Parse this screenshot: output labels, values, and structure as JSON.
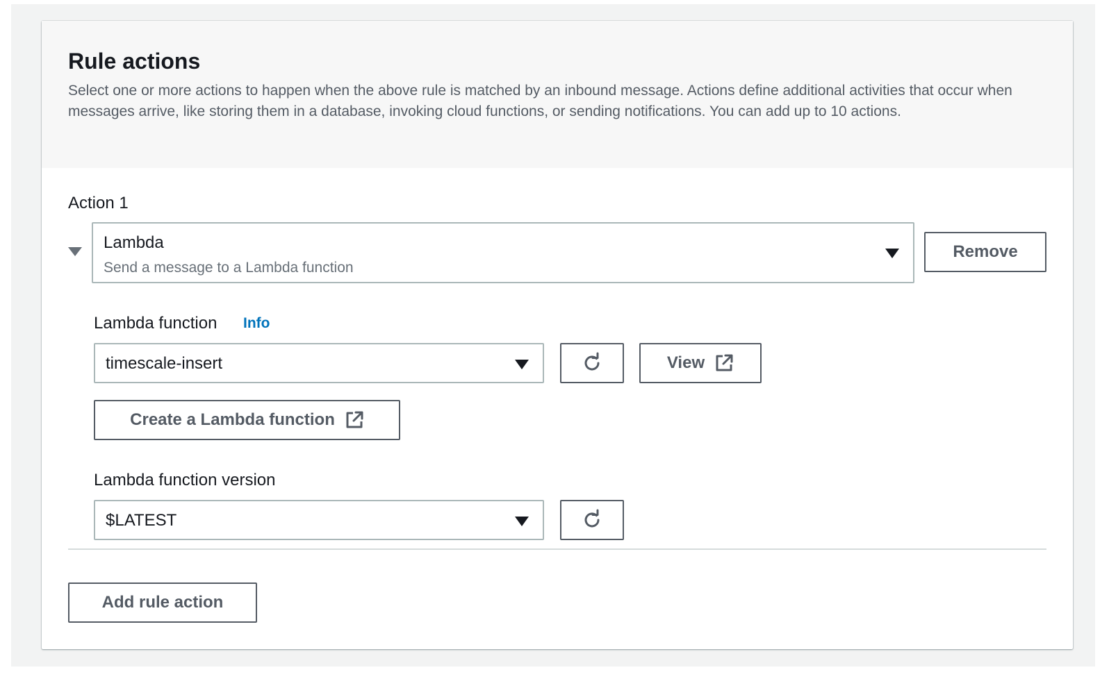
{
  "section": {
    "title": "Rule actions",
    "description": "Select one or more actions to happen when the above rule is matched by an inbound message. Actions define additional activities that occur when messages arrive, like storing them in a database, invoking cloud functions, or sending notifications. You can add up to 10 actions."
  },
  "action": {
    "label": "Action 1",
    "type_value": "Lambda",
    "type_description": "Send a message to a Lambda function",
    "remove_label": "Remove"
  },
  "lambda_function": {
    "label": "Lambda function",
    "info_label": "Info",
    "value": "timescale-insert",
    "view_label": "View",
    "create_label": "Create a Lambda function"
  },
  "lambda_version": {
    "label": "Lambda function version",
    "value": "$LATEST"
  },
  "footer": {
    "add_label": "Add rule action"
  },
  "icons": {
    "collapse": "caret-down-icon",
    "dropdown": "caret-down-icon",
    "refresh": "refresh-icon",
    "external": "external-link-icon"
  },
  "colors": {
    "link": "#0073bb",
    "button_text": "#545b64",
    "border": "#aab7b8",
    "header_bg": "#f7f7f7"
  }
}
